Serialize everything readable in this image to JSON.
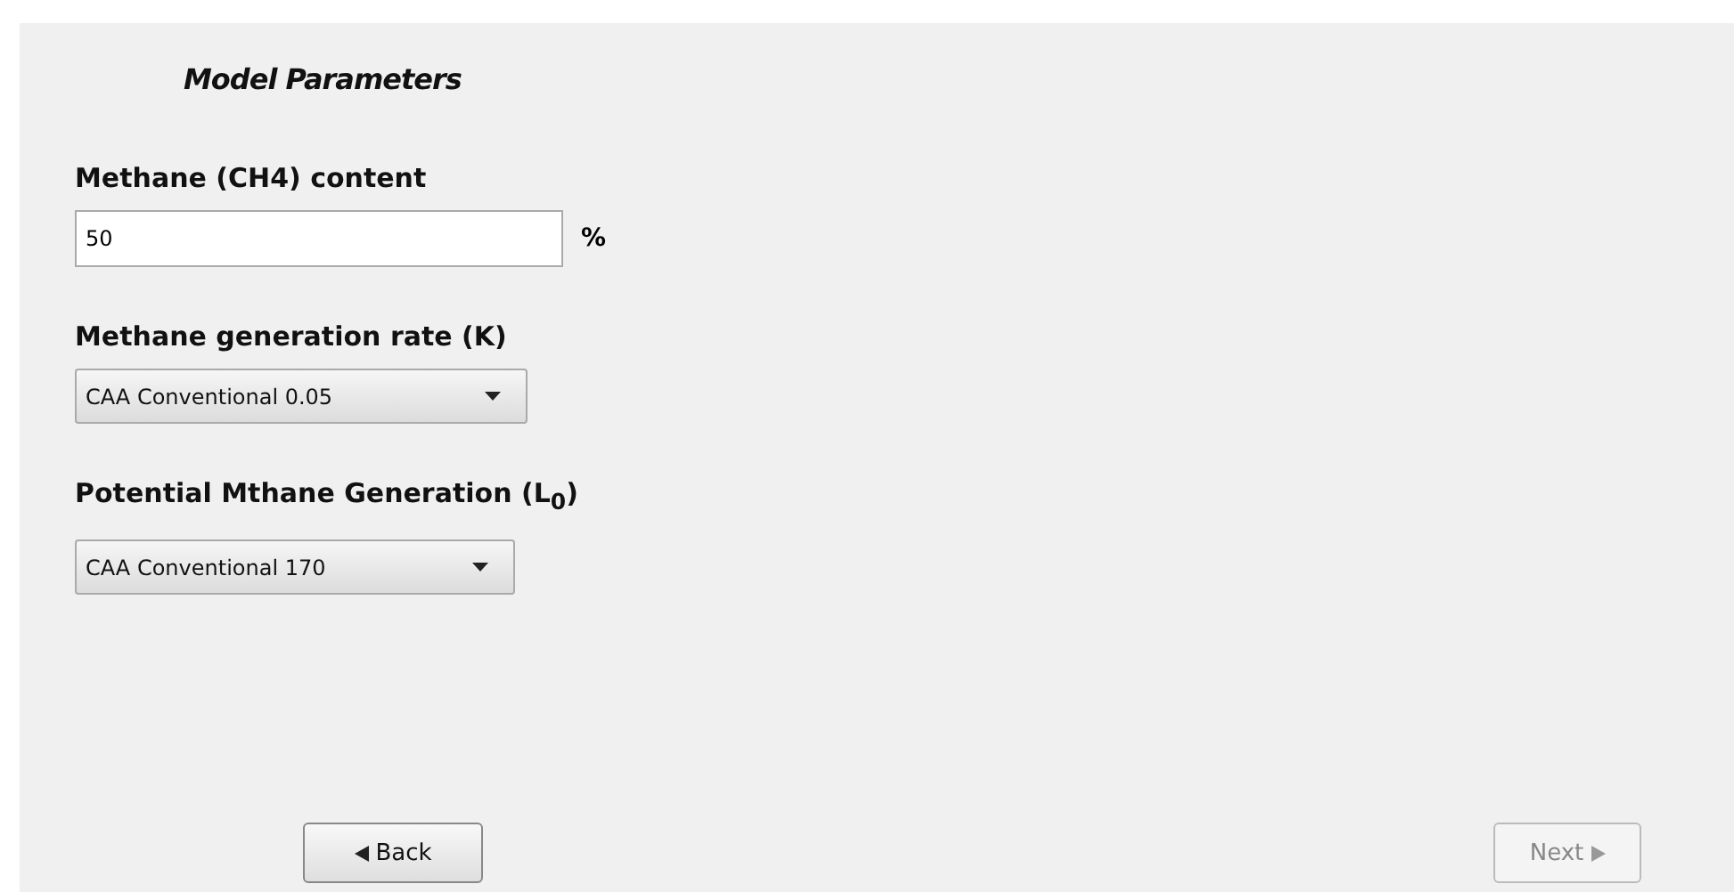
{
  "title": "Model Parameters",
  "fields": [
    {
      "kind": "text",
      "label": "Methane (CH4) content",
      "value": "50",
      "unit": "%"
    },
    {
      "kind": "dropdown",
      "label": "Methane generation rate (K)",
      "value": "CAA Conventional 0.05"
    },
    {
      "kind": "dropdown",
      "label": "Potential Mthane Generation (L$_{0}$)",
      "value": "CAA Conventional 170"
    }
  ],
  "buttons": [
    {
      "kind": "back",
      "label": "Back",
      "disabled": false
    },
    {
      "kind": "next",
      "label": "Next",
      "disabled": true
    }
  ]
}
